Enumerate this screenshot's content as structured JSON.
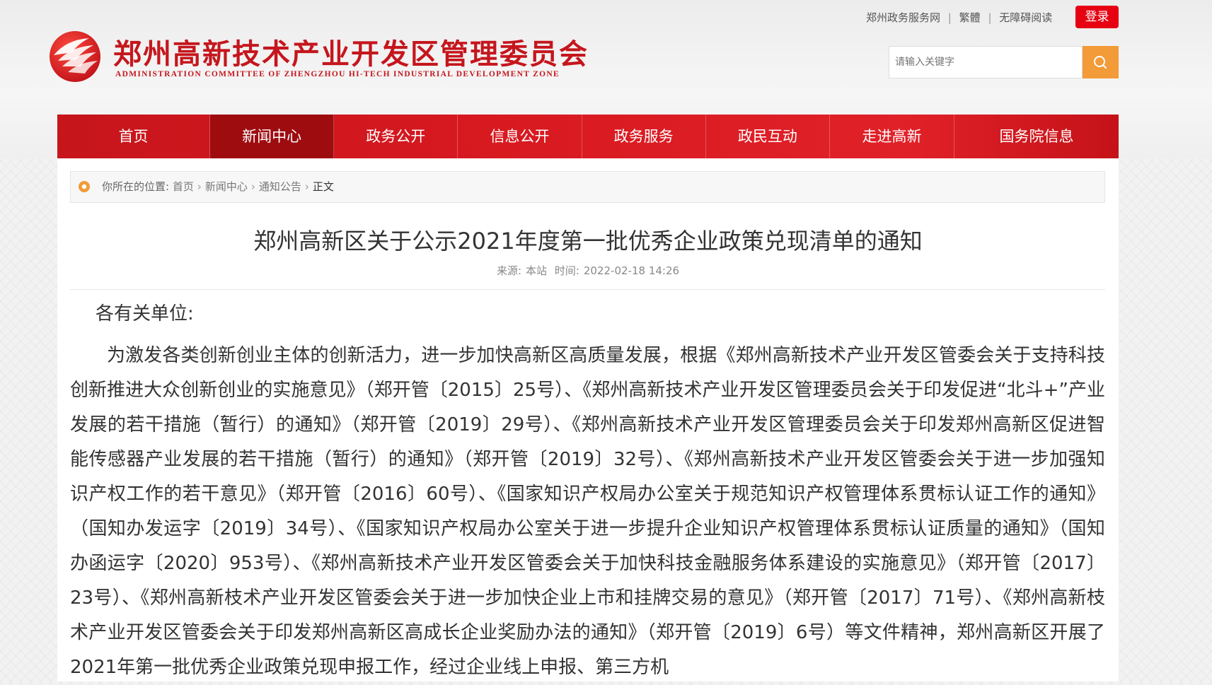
{
  "header": {
    "site_title": "郑州高新技术产业开发区管理委员会",
    "site_subtitle": "ADMINISTRATION COMMITTEE OF ZHENGZHOU HI-TECH INDUSTRIAL DEVELOPMENT ZONE",
    "top_links": [
      "郑州政务服务网",
      "繁體",
      "无障碍阅读"
    ],
    "login_label": "登录",
    "search_placeholder": "请输入关键字",
    "brand_color": "#c5161d"
  },
  "nav": {
    "items": [
      "首页",
      "新闻中心",
      "政务公开",
      "信息公开",
      "政务服务",
      "政民互动",
      "走进高新",
      "国务院信息"
    ],
    "active": "新闻中心"
  },
  "breadcrumb": {
    "prefix": "你所在的位置:",
    "items": [
      "首页",
      "新闻中心",
      "通知公告"
    ],
    "current": "正文"
  },
  "article": {
    "title": "郑州高新区关于公示2021年度第一批优秀企业政策兑现清单的通知",
    "source_label": "来源:",
    "source": "本站",
    "time_label": "时间:",
    "time": "2022-02-18 14:26",
    "greeting": "各有关单位:",
    "paragraph": "为激发各类创新创业主体的创新活力，进一步加快高新区高质量发展，根据《郑州高新技术产业开发区管委会关于支持科技创新推进大众创新创业的实施意见》（郑开管〔2015〕25号）、《郑州高新技术产业开发区管理委员会关于印发促进“北斗+”产业发展的若干措施（暂行）的通知》（郑开管〔2019〕29号）、《郑州高新技术产业开发区管理委员会关于印发郑州高新区促进智能传感器产业发展的若干措施（暂行）的通知》（郑开管〔2019〕32号）、《郑州高新技术产业开发区管委会关于进一步加强知识产权工作的若干意见》（郑开管〔2016〕60号）、《国家知识产权局办公室关于规范知识产权管理体系贯标认证工作的通知》（国知办发运字〔2019〕34号）、《国家知识产权局办公室关于进一步提升企业知识产权管理体系贯标认证质量的通知》（国知办函运字〔2020〕953号）、《郑州高新技术产业开发区管委会关于加快科技金融服务体系建设的实施意见》（郑开管〔2017〕23号）、《郑州高新枝术产业开发区管委会关于进一步加快企业上市和挂牌交易的意见》（郑开管〔2017〕71号）、《郑州高新枝术产业开发区管委会关于印发郑州高新区高成长企业奖励办法的通知》（郑开管〔2019〕6号）等文件精神，郑州高新区开展了2021年第一批优秀企业政策兑现申报工作，经过企业线上申报、第三方机"
  }
}
